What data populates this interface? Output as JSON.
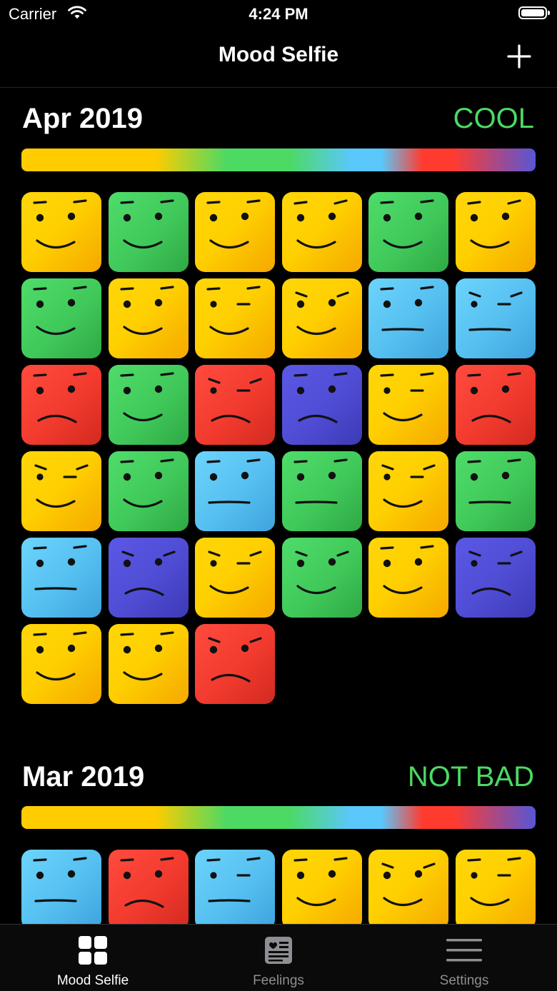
{
  "status_bar": {
    "carrier": "Carrier",
    "time": "4:24 PM"
  },
  "nav": {
    "title": "Mood Selfie",
    "add_icon": "plus-icon"
  },
  "sections": [
    {
      "month": "Apr 2019",
      "mood": "COOL",
      "faces": [
        {
          "color": "yellow",
          "brow": "flat",
          "mouth": "smile"
        },
        {
          "color": "green",
          "brow": "flat",
          "mouth": "smile"
        },
        {
          "color": "yellow",
          "brow": "flat",
          "mouth": "smile"
        },
        {
          "color": "yellow",
          "brow": "tilt",
          "mouth": "smile"
        },
        {
          "color": "green",
          "brow": "flat",
          "mouth": "smile"
        },
        {
          "color": "yellow",
          "brow": "tilt",
          "mouth": "smile"
        },
        {
          "color": "green",
          "brow": "flat",
          "mouth": "smile"
        },
        {
          "color": "yellow",
          "brow": "flat",
          "mouth": "smile"
        },
        {
          "color": "yellow",
          "brow": "flat",
          "mouth": "smile",
          "eyes": "narrow"
        },
        {
          "color": "yellow",
          "brow": "angry",
          "mouth": "smile"
        },
        {
          "color": "blue",
          "brow": "flat",
          "mouth": "flat"
        },
        {
          "color": "blue",
          "brow": "angry",
          "mouth": "flat",
          "eyes": "narrow"
        },
        {
          "color": "red",
          "brow": "flat",
          "mouth": "frown"
        },
        {
          "color": "green",
          "brow": "flat",
          "mouth": "smile"
        },
        {
          "color": "red",
          "brow": "angry",
          "mouth": "frown",
          "eyes": "narrow"
        },
        {
          "color": "purple",
          "brow": "flat",
          "mouth": "frown"
        },
        {
          "color": "yellow",
          "brow": "flat",
          "mouth": "smile",
          "eyes": "narrow"
        },
        {
          "color": "red",
          "brow": "flat",
          "mouth": "frown"
        },
        {
          "color": "yellow",
          "brow": "angry",
          "mouth": "smile",
          "eyes": "narrow"
        },
        {
          "color": "green",
          "brow": "flat",
          "mouth": "smile"
        },
        {
          "color": "blue",
          "brow": "flat",
          "mouth": "flat"
        },
        {
          "color": "green",
          "brow": "flat",
          "mouth": "flat"
        },
        {
          "color": "yellow",
          "brow": "angry",
          "mouth": "smile",
          "eyes": "narrow"
        },
        {
          "color": "green",
          "brow": "flat",
          "mouth": "flat"
        },
        {
          "color": "blue",
          "brow": "flat",
          "mouth": "flat"
        },
        {
          "color": "purple",
          "brow": "angry",
          "mouth": "frown"
        },
        {
          "color": "yellow",
          "brow": "angry",
          "mouth": "smile",
          "eyes": "narrow"
        },
        {
          "color": "green",
          "brow": "angry",
          "mouth": "smile"
        },
        {
          "color": "yellow",
          "brow": "flat",
          "mouth": "smile"
        },
        {
          "color": "purple",
          "brow": "angry",
          "mouth": "frown",
          "eyes": "narrow"
        },
        {
          "color": "yellow",
          "brow": "flat",
          "mouth": "smile"
        },
        {
          "color": "yellow",
          "brow": "flat",
          "mouth": "smile"
        },
        {
          "color": "red",
          "brow": "angry",
          "mouth": "frown"
        }
      ]
    },
    {
      "month": "Mar 2019",
      "mood": "NOT BAD",
      "faces": [
        {
          "color": "blue",
          "brow": "flat",
          "mouth": "flat"
        },
        {
          "color": "red",
          "brow": "flat",
          "mouth": "frown"
        },
        {
          "color": "blue",
          "brow": "flat",
          "mouth": "flat",
          "eyes": "narrow"
        },
        {
          "color": "yellow",
          "brow": "flat",
          "mouth": "smile"
        },
        {
          "color": "yellow",
          "brow": "angry",
          "mouth": "smile"
        },
        {
          "color": "yellow",
          "brow": "flat",
          "mouth": "smile",
          "eyes": "narrow"
        }
      ]
    }
  ],
  "tabs": [
    {
      "label": "Mood Selfie",
      "icon": "grid-icon",
      "active": true
    },
    {
      "label": "Feelings",
      "icon": "journal-icon",
      "active": false
    },
    {
      "label": "Settings",
      "icon": "menu-lines-icon",
      "active": false
    }
  ]
}
